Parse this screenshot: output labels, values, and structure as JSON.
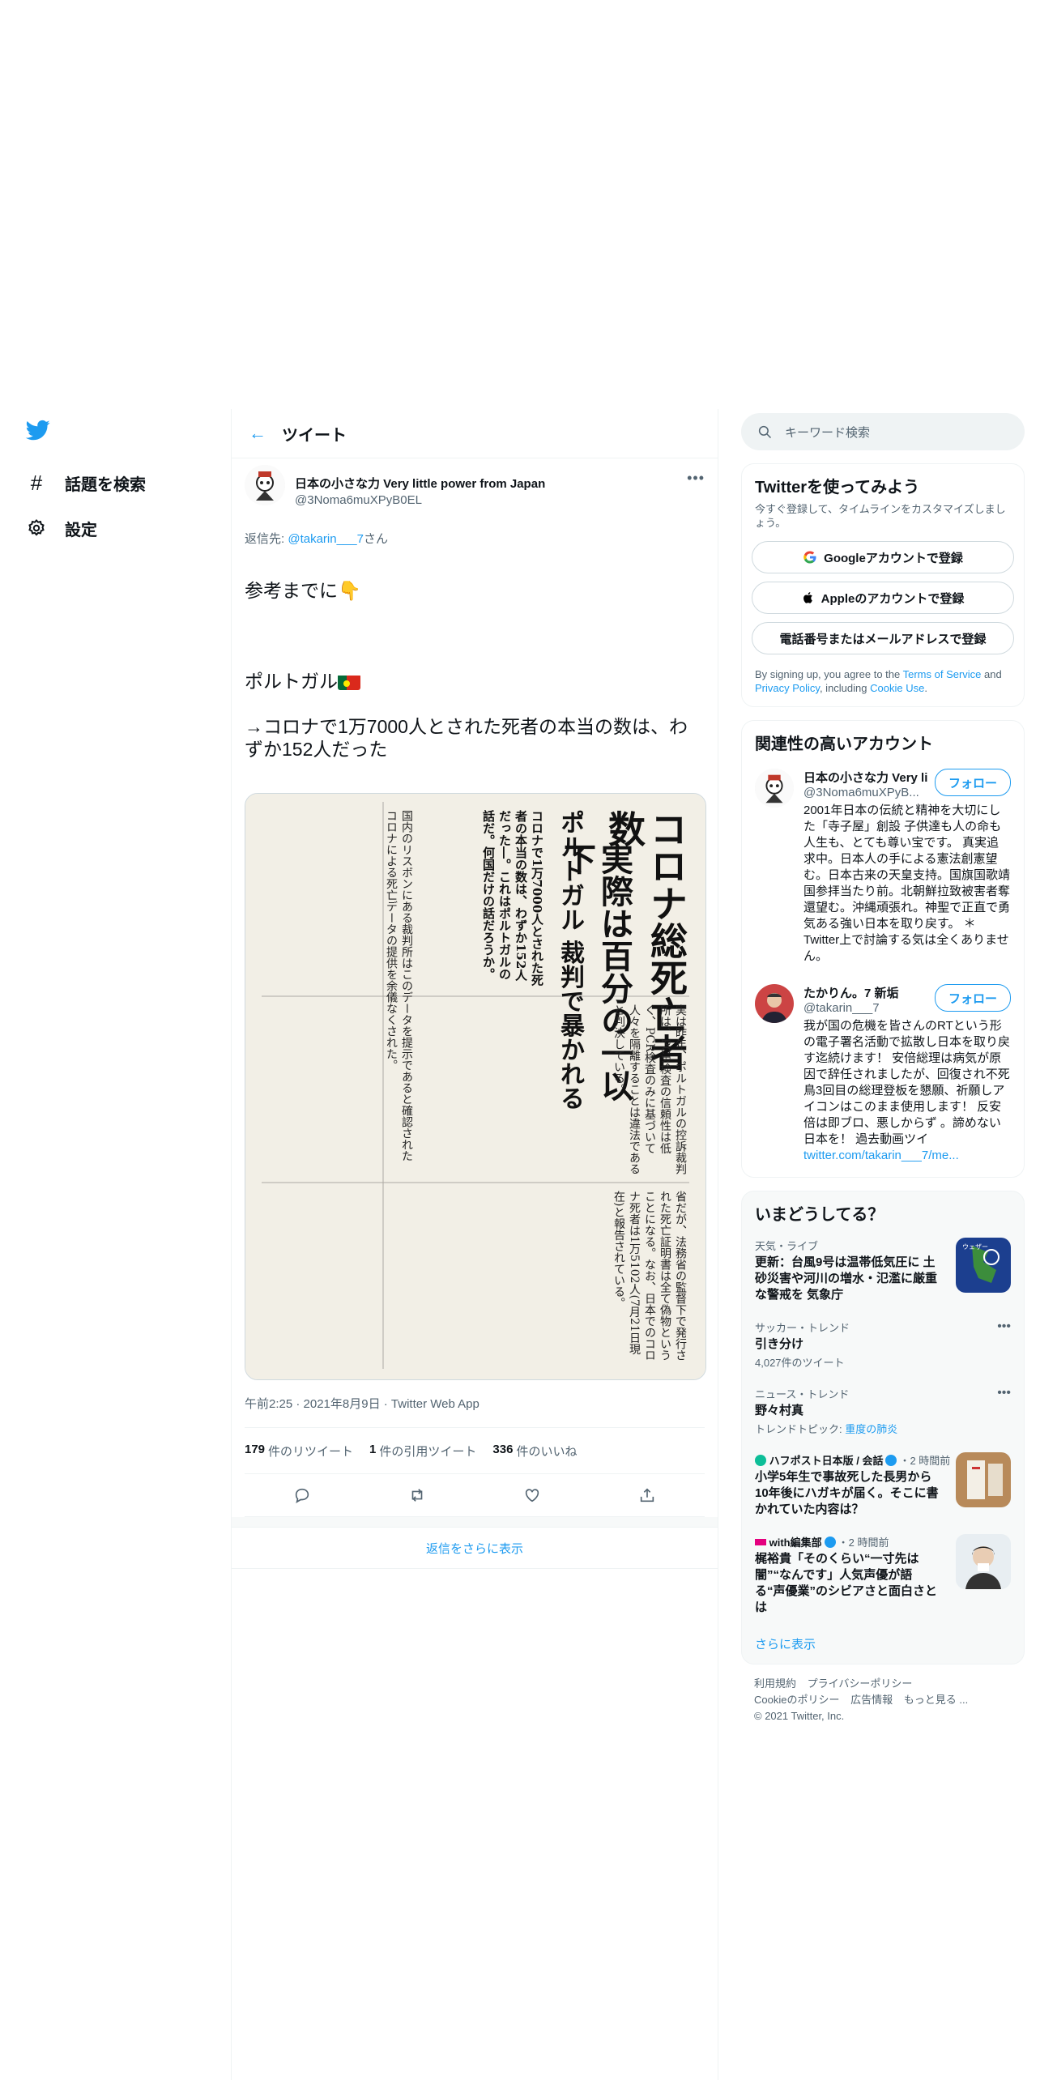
{
  "nav": {
    "items": [
      {
        "icon": "hashtag-icon",
        "label": "話題を検索"
      },
      {
        "icon": "gear-icon",
        "label": "設定"
      }
    ]
  },
  "main": {
    "title": "ツイート",
    "tweet": {
      "author_name": "日本の小さな力 Very little power from Japan",
      "author_handle": "@3Noma6muXPyB0EL",
      "reply_prefix": "返信先: ",
      "reply_handle": "@takarin___7",
      "reply_suffix": "さん",
      "line1": "参考までに👇",
      "line2": "ポルトガル",
      "line3": "→コロナで1万7000人とされた死者の本当の数は、わずか152人だった",
      "image_headline": "コロナ総死亡者数",
      "image_subhead": "実際は百分の一以下",
      "image_subhead2": "ポルトガル 裁判で暴かれる",
      "image_col1": "コロナで1万7000人とされた死者の本当の数は、わずか152人だった―。これはポルトガルの話だ。何国だけの話だろうか。",
      "image_col2": "国内のリスボンにある裁判所はこのデータを提示であると確認されたコロナによる死亡データの提供を余儀なくされた。",
      "image_col3": "実は昨年、ポルトガルの控訴裁判所は、PCR検査の信頼性は低く、PCR検査のみに基づいて人々を隔離することは違法であると判決している。",
      "image_col4": "省だが、法務省の監督下で発行された死亡証明書は全て偽物ということになる。なお、日本でのコロナ死者は1万5102人(7月21日現在)と報告されている。",
      "timestamp": "午前2:25 · 2021年8月9日 · Twitter Web App",
      "stats": [
        {
          "num": "179",
          "label": "件のリツイート"
        },
        {
          "num": "1",
          "label": "件の引用ツイート"
        },
        {
          "num": "336",
          "label": "件のいいね"
        }
      ]
    },
    "show_more_replies": "返信をさらに表示"
  },
  "sidebar": {
    "search_placeholder": "キーワード検索",
    "signup": {
      "title": "Twitterを使ってみよう",
      "subtitle": "今すぐ登録して、タイムラインをカスタマイズしましょう。",
      "google": "Googleアカウントで登録",
      "apple": "Appleのアカウントで登録",
      "phone": "電話番号またはメールアドレスで登録",
      "legal_prefix": "By signing up, you agree to the ",
      "terms": "Terms of Service",
      "and": " and ",
      "privacy": "Privacy Policy",
      "including": ", including ",
      "cookie": "Cookie Use",
      "period": "."
    },
    "related": {
      "title": "関連性の高いアカウント",
      "accounts": [
        {
          "name": "日本の小さな力 Very li",
          "handle": "@3Noma6muXPyB...",
          "follow": "フォロー",
          "bio": "2001年日本の伝統と精神を大切にした「寺子屋」創設 子供達も人の命も人生も、とても尊い宝です。 真実追求中。日本人の手による憲法創憲望む。日本古来の天皇支持。国旗国歌靖国参拝当たり前。北朝鮮拉致被害者奪還望む。沖縄頑張れ。神聖で正直で勇気ある強い日本を取り戻す。 ＊Twitter上で討論する気は全くありません。"
        },
        {
          "name": "たかりん。7 新垢",
          "handle": "@takarin___7",
          "follow": "フォロー",
          "bio": "我が国の危機を皆さんのRTという形の電子署名活動で拡散し日本を取り戻す迄続けます！ 安倍総理は病気が原因で辞任されましたが、回復され不死鳥3回目の総理登板を懇願、祈願しアイコンはこのまま使用します！ 反安倍は即ブロ、悪しからず 。諦めない日本を！ 過去動画ツイ",
          "link": "twitter.com/takarin___7/me..."
        }
      ]
    },
    "trends": {
      "title": "いまどうしてる？",
      "items": [
        {
          "cat": "天気・ライブ",
          "title": "更新：台風9号は温帯低気圧に 土砂災害や河川の増水・氾濫に厳重な警戒を 気象庁"
        },
        {
          "cat": "サッカー・トレンド",
          "title": "引き分け",
          "sub": "4,027件のツイート"
        },
        {
          "cat": "ニュース・トレンド",
          "title": "野々村真",
          "sub_prefix": "トレンドトピック: ",
          "sub_link": "重度の肺炎"
        },
        {
          "source": "ハフポスト日本版 / 会話",
          "time": "・2 時間前",
          "title": "小学5年生で事故死した長男から10年後にハガキが届く。そこに書かれていた内容は？"
        },
        {
          "source": "with編集部",
          "time": "・2 時間前",
          "title": "梶裕貴「そのくらい“一寸先は闇”“なんです」人気声優が語る“声優業”のシビアさと面白さとは"
        }
      ],
      "show_more": "さらに表示"
    },
    "footer": {
      "links": [
        "利用規約",
        "プライバシーポリシー",
        "Cookieのポリシー",
        "広告情報",
        "もっと見る ..."
      ],
      "copyright": "© 2021 Twitter, Inc."
    }
  },
  "colors": {
    "accent": "#1d9bf0",
    "text": "#0f1419",
    "muted": "#536471"
  }
}
